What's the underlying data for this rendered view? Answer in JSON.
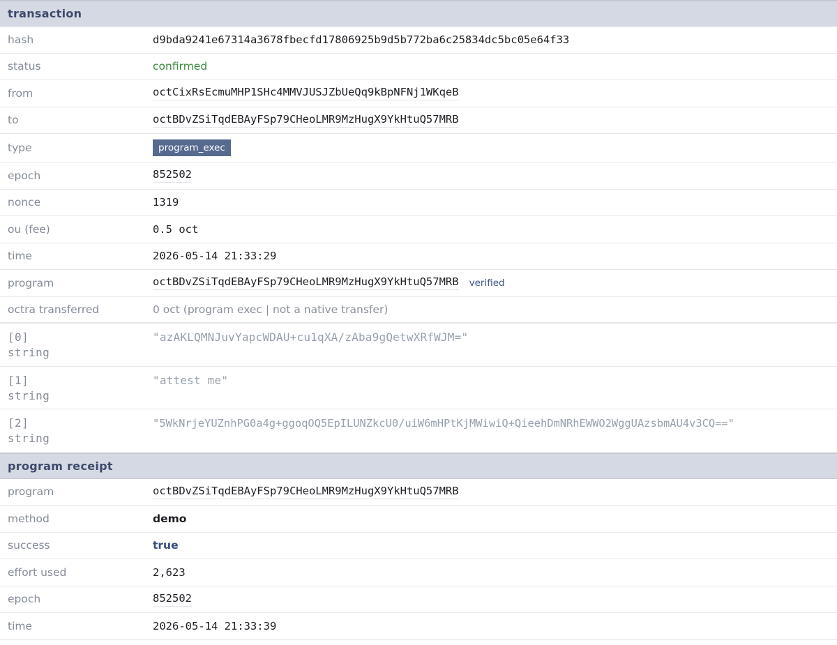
{
  "transaction": {
    "title": "transaction",
    "hash": {
      "label": "hash",
      "value": "d9bda9241e67314a3678fbecfd17806925b9d5b772ba6c25834dc5bc05e64f33"
    },
    "status": {
      "label": "status",
      "value": "confirmed",
      "color": "#3b8a3e"
    },
    "from": {
      "label": "from",
      "value": "octCixRsEcmuMHP1SHc4MMVJUSJZbUeQq9kBpNFNj1WKqeB"
    },
    "to": {
      "label": "to",
      "value": "octBDvZSiTqdEBAyFSp79CHeoLMR9MzHugX9YkHtuQ57MRB"
    },
    "type": {
      "label": "type",
      "value": "program_exec",
      "badge_color": "#56698f"
    },
    "epoch": {
      "label": "epoch",
      "value": "852502"
    },
    "nonce": {
      "label": "nonce",
      "value": "1319"
    },
    "fee": {
      "label": "ou (fee)",
      "value": "0.5 oct"
    },
    "time": {
      "label": "time",
      "value": "2026-05-14 21:33:29"
    },
    "program": {
      "label": "program",
      "value": "octBDvZSiTqdEBAyFSp79CHeoLMR9MzHugX9YkHtuQ57MRB",
      "verified": "verified"
    },
    "transferred": {
      "label": "octra transferred",
      "value": "0 oct (program exec | not a native transfer)"
    },
    "args": [
      {
        "index": "[0]",
        "type": "string",
        "value": "\"azAKLQMNJuvYapcWDAU+cu1qXA/zAba9gQetwXRfWJM=\""
      },
      {
        "index": "[1]",
        "type": "string",
        "value": "\"attest me\""
      },
      {
        "index": "[2]",
        "type": "string",
        "value": "\"5WkNrjeYUZnhPG0a4g+ggoqOQ5EpILUNZkcU0/uiW6mHPtKjMWiwiQ+QieehDmNRhEWWO2WggUAzsbmAU4v3CQ==\""
      }
    ]
  },
  "receipt": {
    "title": "program receipt",
    "program": {
      "label": "program",
      "value": "octBDvZSiTqdEBAyFSp79CHeoLMR9MzHugX9YkHtuQ57MRB"
    },
    "method": {
      "label": "method",
      "value": "demo"
    },
    "success": {
      "label": "success",
      "value": "true"
    },
    "effort": {
      "label": "effort used",
      "value": "2,623"
    },
    "epoch": {
      "label": "epoch",
      "value": "852502"
    },
    "time": {
      "label": "time",
      "value": "2026-05-14 21:33:39"
    }
  }
}
